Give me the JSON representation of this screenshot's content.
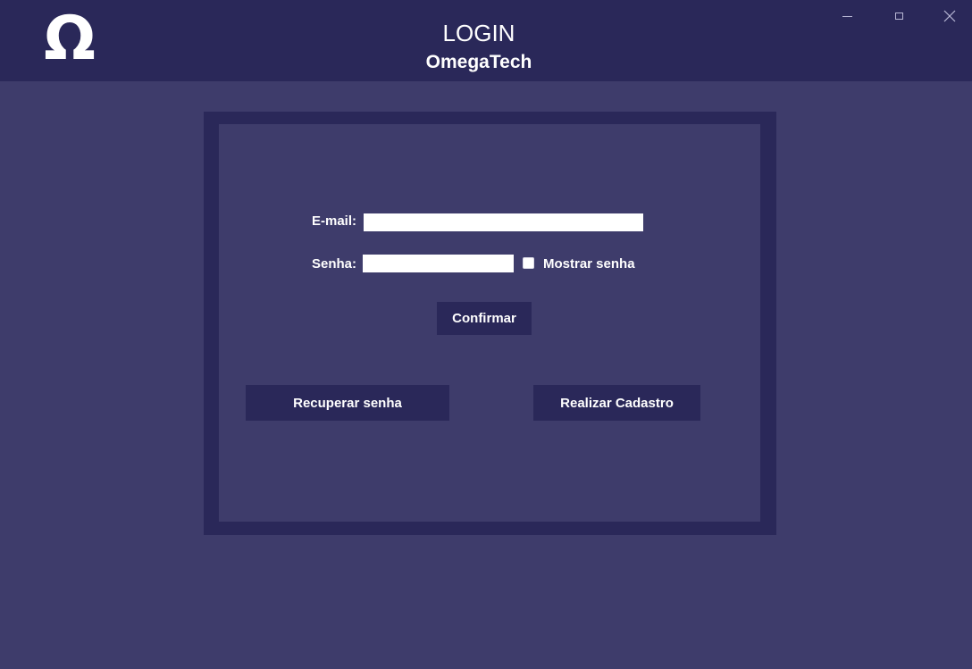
{
  "header": {
    "logo_glyph": "Ω",
    "title": "LOGIN",
    "subtitle": "OmegaTech"
  },
  "window_controls": {
    "minimize_icon": "minimize-icon",
    "maximize_icon": "maximize-icon",
    "close_icon": "close-icon"
  },
  "form": {
    "email_label": "E-mail:",
    "email_value": "",
    "senha_label": "Senha:",
    "senha_value": "",
    "show_password_label": "Mostrar senha",
    "show_password_checked": false,
    "confirm_label": "Confirmar",
    "recover_label": "Recuperar senha",
    "register_label": "Realizar Cadastro"
  },
  "colors": {
    "background": "#3e3c6b",
    "header": "#2a2859",
    "button": "#2a2859",
    "text": "#ffffff"
  }
}
